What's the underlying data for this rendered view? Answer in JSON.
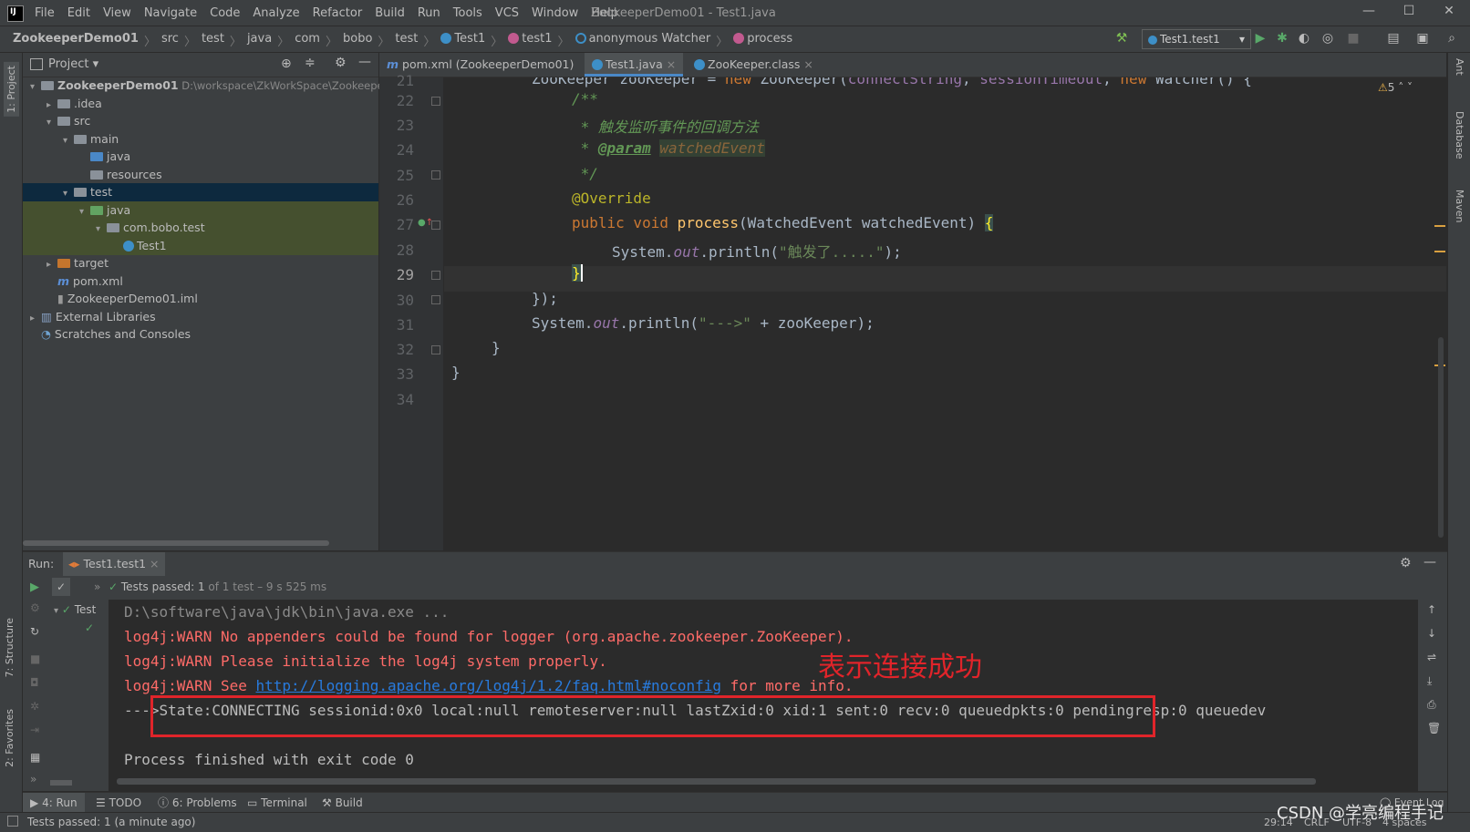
{
  "menubar": {
    "items": [
      "File",
      "Edit",
      "View",
      "Navigate",
      "Code",
      "Analyze",
      "Refactor",
      "Build",
      "Run",
      "Tools",
      "VCS",
      "Window",
      "Help"
    ],
    "title": "ZookeeperDemo01 - Test1.java"
  },
  "navbar": {
    "crumbs": [
      "ZookeeperDemo01",
      "src",
      "test",
      "java",
      "com",
      "bobo",
      "test",
      "Test1",
      "test1",
      "anonymous Watcher",
      "process"
    ],
    "run_config": "Test1.test1"
  },
  "project": {
    "header": "Project",
    "tree": [
      {
        "label": "ZookeeperDemo01",
        "extra": "D:\\workspace\\ZkWorkSpace\\Zookeeper",
        "depth": 0,
        "arrow": "▾",
        "icon": "folder",
        "bold": true
      },
      {
        "label": ".idea",
        "depth": 1,
        "arrow": "▸",
        "icon": "folder"
      },
      {
        "label": "src",
        "depth": 1,
        "arrow": "▾",
        "icon": "folder"
      },
      {
        "label": "main",
        "depth": 2,
        "arrow": "▾",
        "icon": "folder"
      },
      {
        "label": "java",
        "depth": 3,
        "arrow": "",
        "icon": "folder-blue"
      },
      {
        "label": "resources",
        "depth": 3,
        "arrow": "",
        "icon": "folder"
      },
      {
        "label": "test",
        "depth": 2,
        "arrow": "▾",
        "icon": "folder",
        "selected": true
      },
      {
        "label": "java",
        "depth": 3,
        "arrow": "▾",
        "icon": "folder-green",
        "highlight": true
      },
      {
        "label": "com.bobo.test",
        "depth": 4,
        "arrow": "▾",
        "icon": "folder",
        "highlight": true
      },
      {
        "label": "Test1",
        "depth": 5,
        "arrow": "",
        "icon": "class",
        "highlight": true
      },
      {
        "label": "target",
        "depth": 1,
        "arrow": "▸",
        "icon": "folder-orange"
      },
      {
        "label": "pom.xml",
        "depth": 1,
        "arrow": "",
        "icon": "maven"
      },
      {
        "label": "ZookeeperDemo01.iml",
        "depth": 1,
        "arrow": "",
        "icon": "file"
      },
      {
        "label": "External Libraries",
        "depth": 0,
        "arrow": "▸",
        "icon": "lib"
      },
      {
        "label": "Scratches and Consoles",
        "depth": 0,
        "arrow": "",
        "icon": "scratch"
      }
    ]
  },
  "left_strip": {
    "project_tab": "1: Project",
    "structure_tab": "7: Structure",
    "favorites_tab": "2: Favorites"
  },
  "right_strip": {
    "ant": "Ant",
    "database": "Database",
    "maven": "Maven"
  },
  "editor": {
    "tabs": [
      "pom.xml (ZookeeperDemo01)",
      "Test1.java",
      "ZooKeeper.class"
    ],
    "warnings": "5",
    "line_numbers": [
      "21",
      "22",
      "23",
      "24",
      "25",
      "26",
      "27",
      "28",
      "29",
      "30",
      "31",
      "32",
      "33",
      "34"
    ]
  },
  "run": {
    "label": "Run:",
    "tab": "Test1.test1",
    "tests_passed": "Tests passed:",
    "tests_count": "1",
    "tests_detail": "of 1 test – 9 s 525 ms",
    "tree_root": "Test",
    "console": {
      "line1": "D:\\software\\java\\jdk\\bin\\java.exe ...",
      "line2": "log4j:WARN No appenders could be found for logger (org.apache.zookeeper.ZooKeeper).",
      "line3": "log4j:WARN Please initialize the log4j system properly.",
      "line4_pre": "log4j:WARN See ",
      "line4_link": "http://logging.apache.org/log4j/1.2/faq.html#noconfig",
      "line4_post": " for more info.",
      "line5": "--->State:CONNECTING sessionid:0x0 local:null remoteserver:null lastZxid:0 xid:1 sent:0 recv:0 queuedpkts:0 pendingresp:0 queuedev",
      "line6": "Process finished with exit code 0"
    },
    "annotation": "表示连接成功"
  },
  "bottom_tabs": [
    "4: Run",
    "TODO",
    "6: Problems",
    "Terminal",
    "Build"
  ],
  "status": {
    "message": "Tests passed: 1 (a minute ago)",
    "position": "29:14",
    "line_sep": "CRLF",
    "encoding": "UTF-8",
    "indent": "4 spaces",
    "event_log": "Event Log"
  },
  "watermark": "CSDN @学亮编程手记"
}
